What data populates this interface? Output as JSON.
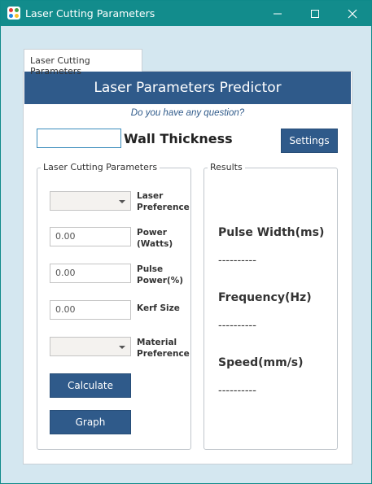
{
  "window": {
    "title": "Laser Cutting Parameters"
  },
  "tab": {
    "label": "Laser Cutting Parameters"
  },
  "banner": {
    "title": "Laser Parameters Predictor"
  },
  "question_link": "Do you have any question?",
  "wall": {
    "input_value": "",
    "label": "Wall Thickness"
  },
  "settings_label": "Settings",
  "params_group": {
    "title": "Laser Cutting Parameters",
    "laser_preference": {
      "value": "",
      "label_line1": "Laser",
      "label_line2": "Preference"
    },
    "power": {
      "value": "0.00",
      "label_line1": "Power",
      "label_line2": "(Watts)"
    },
    "pulse_power": {
      "value": "0.00",
      "label_line1": "Pulse",
      "label_line2": "Power(%)"
    },
    "kerf": {
      "value": "0.00",
      "label_line1": "Kerf Size"
    },
    "material_preference": {
      "value": "",
      "label_line1": "Material",
      "label_line2": "Preference"
    },
    "calculate_label": "Calculate",
    "graph_label": "Graph"
  },
  "results_group": {
    "title": "Results",
    "pulse_width": {
      "label": "Pulse Width(ms)",
      "value": "----------"
    },
    "frequency": {
      "label": "Frequency(Hz)",
      "value": "----------"
    },
    "speed": {
      "label": "Speed(mm/s)",
      "value": "----------"
    }
  },
  "colors": {
    "titlebar": "#128c8c",
    "accent": "#2f5a8a",
    "background": "#d4e7f0"
  }
}
